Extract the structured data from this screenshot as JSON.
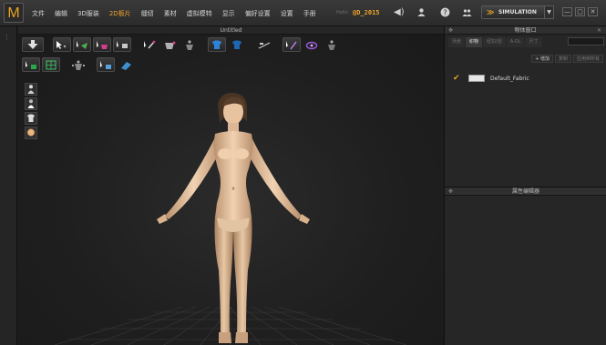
{
  "app": {
    "logo_letter": "M"
  },
  "menu": {
    "items": [
      "文件",
      "编辑",
      "3D服装",
      "2D板片",
      "缝纫",
      "素材",
      "虚拟模特",
      "显示",
      "偏好设置",
      "设置",
      "手册"
    ],
    "active_index": 4,
    "hello_text": "Hello",
    "username": "@D_2015"
  },
  "topbar": {
    "icons": [
      "speaker-icon",
      "user-icon",
      "help-icon",
      "community-icon"
    ],
    "simulation_label": "SIMULATION",
    "window_controls": [
      "—",
      "▢",
      "✕"
    ]
  },
  "viewport": {
    "title": "Untitled",
    "toolbar_row1": [
      "arrow-down-icon",
      "select-move-icon",
      "fold-icon",
      "tuck-icon",
      "pin-icon",
      "brush-icon",
      "drape-icon",
      "avatar-pose-icon",
      "shirt-front-icon",
      "shirt-back-icon",
      "measure-icon",
      "magic-wand-icon",
      "cycle-icon",
      "avatar-fit-icon"
    ],
    "toolbar_row2": [
      "select-pattern-icon",
      "grid-icon",
      "avatar-arrange-icon",
      "segment-icon",
      "texture-icon"
    ],
    "side_tools": [
      "avatar-body-icon",
      "avatar-half-icon",
      "garment-icon",
      "head-icon"
    ]
  },
  "object_browser": {
    "title": "物体窗口",
    "tabs": [
      "场景",
      "织物",
      "纽扣/钮",
      "A-DL",
      "尺寸"
    ],
    "active_tab_index": 1,
    "buttons": [
      "+ 增加",
      "复制",
      "应用到所有"
    ],
    "fabrics": [
      {
        "name": "Default_Fabric",
        "checked": true,
        "swatch_color": "#e6e6e6"
      }
    ]
  },
  "property_editor": {
    "title": "属性编辑器"
  },
  "colors": {
    "accent": "#f0a22a",
    "background": "#1e1e1e",
    "panel": "#262626",
    "skin": "#e6c3a3"
  }
}
